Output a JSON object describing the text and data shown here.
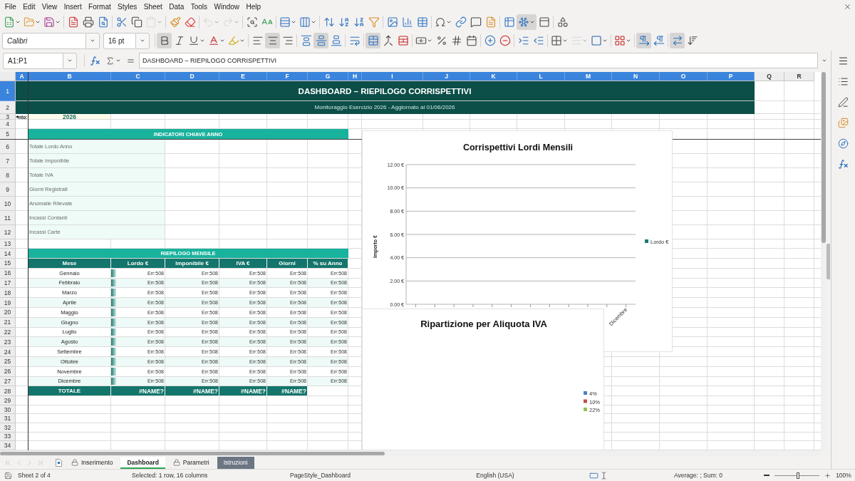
{
  "menu": [
    "File",
    "Edit",
    "View",
    "Insert",
    "Format",
    "Styles",
    "Sheet",
    "Data",
    "Tools",
    "Window",
    "Help"
  ],
  "standard_toolbar": [
    {
      "on": false,
      "disabled": false
    },
    {
      "on": false,
      "disabled": false
    },
    {
      "on": false,
      "disabled": false
    },
    {
      "on": false,
      "disabled": false
    },
    {
      "on": false,
      "disabled": false
    },
    {
      "on": false,
      "disabled": false
    },
    {
      "on": false,
      "disabled": false
    },
    {
      "on": false,
      "disabled": false
    },
    {
      "on": false,
      "disabled": true
    },
    {
      "on": false,
      "disabled": false
    },
    {
      "on": false,
      "disabled": false
    },
    {
      "on": false,
      "disabled": true
    },
    {
      "on": false,
      "disabled": true
    },
    {
      "on": false,
      "disabled": false
    },
    {
      "on": false,
      "disabled": false
    },
    {
      "on": false,
      "disabled": false
    },
    {
      "on": false,
      "disabled": false
    },
    {
      "on": false,
      "disabled": false
    },
    {
      "on": false,
      "disabled": false
    },
    {
      "on": false,
      "disabled": false
    },
    {
      "on": false,
      "disabled": false
    },
    {
      "on": false,
      "disabled": false
    },
    {
      "on": false,
      "disabled": false
    },
    {
      "on": false,
      "disabled": false
    },
    {
      "on": false,
      "disabled": false
    },
    {
      "on": false,
      "disabled": false
    },
    {
      "on": false,
      "disabled": false
    },
    {
      "on": false,
      "disabled": false
    },
    {
      "on": false,
      "disabled": false
    },
    {
      "on": true,
      "disabled": false
    },
    {
      "on": false,
      "disabled": false
    },
    {
      "on": false,
      "disabled": false
    }
  ],
  "formatting_toolbar": {
    "font_name": "Calibri",
    "font_size": "16 pt",
    "buttons": [
      {
        "on": true,
        "disabled": false
      },
      {
        "on": false,
        "disabled": false
      },
      {
        "on": false,
        "disabled": false
      },
      {
        "on": false,
        "disabled": false
      },
      {
        "on": false,
        "disabled": false
      },
      {
        "on": false,
        "disabled": false
      },
      {
        "on": true,
        "disabled": false
      },
      {
        "on": false,
        "disabled": false
      },
      {
        "on": false,
        "disabled": false
      },
      {
        "on": true,
        "disabled": false
      },
      {
        "on": false,
        "disabled": false
      },
      {
        "on": false,
        "disabled": false
      },
      {
        "on": true,
        "disabled": false
      },
      {
        "on": false,
        "disabled": false
      },
      {
        "on": false,
        "disabled": false
      },
      {
        "on": false,
        "disabled": false
      },
      {
        "on": false,
        "disabled": false
      },
      {
        "on": false,
        "disabled": false
      },
      {
        "on": false,
        "disabled": false
      },
      {
        "on": false,
        "disabled": false
      },
      {
        "on": false,
        "disabled": false
      },
      {
        "on": false,
        "disabled": false
      },
      {
        "on": false,
        "disabled": false
      },
      {
        "on": false,
        "disabled": false
      },
      {
        "on": false,
        "disabled": true
      },
      {
        "on": false,
        "disabled": false
      },
      {
        "on": false,
        "disabled": false
      },
      {
        "on": true,
        "disabled": false
      },
      {
        "on": false,
        "disabled": false
      },
      {
        "on": true,
        "disabled": false
      },
      {
        "on": false,
        "disabled": false
      }
    ]
  },
  "formula_bar": {
    "name_box": "A1:P1",
    "formula": "DASHBOARD – RIEPILOGO CORRISPETTIVI"
  },
  "sheet": {
    "columns": [
      {
        "label": "A",
        "selected": true
      },
      {
        "label": "B",
        "selected": true
      },
      {
        "label": "C",
        "selected": true
      },
      {
        "label": "D",
        "selected": true
      },
      {
        "label": "E",
        "selected": true
      },
      {
        "label": "F",
        "selected": true
      },
      {
        "label": "G",
        "selected": true
      },
      {
        "label": "H",
        "selected": true
      },
      {
        "label": "I",
        "selected": true
      },
      {
        "label": "J",
        "selected": true
      },
      {
        "label": "K",
        "selected": true
      },
      {
        "label": "L",
        "selected": true
      },
      {
        "label": "M",
        "selected": true
      },
      {
        "label": "N",
        "selected": true
      },
      {
        "label": "O",
        "selected": true
      },
      {
        "label": "P",
        "selected": true
      },
      {
        "label": "Q",
        "selected": false
      },
      {
        "label": "R",
        "selected": false
      }
    ],
    "rows": [
      {
        "label": "1",
        "selected": true
      },
      {
        "label": "2",
        "selected": false
      },
      {
        "label": "3",
        "selected": false
      },
      {
        "label": "4",
        "selected": false
      },
      {
        "label": "5",
        "selected": false
      },
      {
        "label": "6",
        "selected": false
      },
      {
        "label": "7",
        "selected": false
      },
      {
        "label": "8",
        "selected": false
      },
      {
        "label": "9",
        "selected": false
      },
      {
        "label": "10",
        "selected": false
      },
      {
        "label": "11",
        "selected": false
      },
      {
        "label": "12",
        "selected": false
      },
      {
        "label": "13",
        "selected": false
      },
      {
        "label": "14",
        "selected": false
      },
      {
        "label": "15",
        "selected": false
      },
      {
        "label": "16",
        "selected": false
      },
      {
        "label": "17",
        "selected": false
      },
      {
        "label": "18",
        "selected": false
      },
      {
        "label": "19",
        "selected": false
      },
      {
        "label": "20",
        "selected": false
      },
      {
        "label": "21",
        "selected": false
      },
      {
        "label": "22",
        "selected": false
      },
      {
        "label": "23",
        "selected": false
      },
      {
        "label": "24",
        "selected": false
      },
      {
        "label": "25",
        "selected": false
      },
      {
        "label": "26",
        "selected": false
      },
      {
        "label": "27",
        "selected": false
      },
      {
        "label": "28",
        "selected": false
      },
      {
        "label": "29",
        "selected": false
      },
      {
        "label": "30",
        "selected": false
      },
      {
        "label": "31",
        "selected": false
      },
      {
        "label": "32",
        "selected": false
      },
      {
        "label": "33",
        "selected": false
      },
      {
        "label": "34",
        "selected": false
      }
    ],
    "title": "DASHBOARD – RIEPILOGO CORRISPETTIVI",
    "subtitle": "Monitoraggio Esercizio 2026 - Aggiornato al 01/06/2026",
    "year_label": "nto:",
    "year": "2026",
    "kpi_header": "INDICATORI CHIAVE ANNO",
    "kpis": [
      "Totale Lordo Anno",
      "Totale Imponibile",
      "Totale IVA",
      "Giorni Registrati",
      "Anomalie Rilevate",
      "Incassi Contanti",
      "Incassi Carte"
    ],
    "summary_header": "RIEPILOGO MENSILE",
    "summary_columns": [
      "Mese",
      "Lordo €",
      "Imponibile €",
      "IVA €",
      "Giorni",
      "% su Anno"
    ],
    "months": [
      {
        "name": "Gennaio",
        "values": [
          "Err:508",
          "Err:508",
          "Err:508",
          "Err:508",
          "Err:508"
        ]
      },
      {
        "name": "Febbraio",
        "values": [
          "Err:508",
          "Err:508",
          "Err:508",
          "Err:508",
          "Err:508"
        ]
      },
      {
        "name": "Marzo",
        "values": [
          "Err:508",
          "Err:508",
          "Err:508",
          "Err:508",
          "Err:508"
        ]
      },
      {
        "name": "Aprile",
        "values": [
          "Err:508",
          "Err:508",
          "Err:508",
          "Err:508",
          "Err:508"
        ]
      },
      {
        "name": "Maggio",
        "values": [
          "Err:508",
          "Err:508",
          "Err:508",
          "Err:508",
          "Err:508"
        ]
      },
      {
        "name": "Giugno",
        "values": [
          "Err:508",
          "Err:508",
          "Err:508",
          "Err:508",
          "Err:508"
        ]
      },
      {
        "name": "Luglio",
        "values": [
          "Err:508",
          "Err:508",
          "Err:508",
          "Err:508",
          "Err:508"
        ]
      },
      {
        "name": "Agosto",
        "values": [
          "Err:508",
          "Err:508",
          "Err:508",
          "Err:508",
          "Err:508"
        ]
      },
      {
        "name": "Settembre",
        "values": [
          "Err:508",
          "Err:508",
          "Err:508",
          "Err:508",
          "Err:508"
        ]
      },
      {
        "name": "Ottobre",
        "values": [
          "Err:508",
          "Err:508",
          "Err:508",
          "Err:508",
          "Err:508"
        ]
      },
      {
        "name": "Novembre",
        "values": [
          "Err:508",
          "Err:508",
          "Err:508",
          "Err:508",
          "Err:508"
        ]
      },
      {
        "name": "Dicembre",
        "values": [
          "Err:508",
          "Err:508",
          "Err:508",
          "Err:508",
          "Err:508"
        ]
      }
    ],
    "totals": {
      "label": "TOTALE",
      "values": [
        "#NAME?",
        "#NAME?",
        "#NAME?",
        "#NAME?"
      ]
    }
  },
  "charts": [
    {
      "kind": "bar",
      "title": "Corrispettivi Lordi Mensili",
      "axis_title": "Importo €",
      "y_ticks": [
        "12.00 €",
        "10.00 €",
        "8.00 €",
        "6.00 €",
        "4.00 €",
        "2.00 €",
        "0.00 €"
      ],
      "x_labels": [
        "Dicembre"
      ],
      "legend": [
        {
          "label": "Lordo €",
          "color": "#1b7a70"
        }
      ]
    },
    {
      "kind": "pie",
      "title": "Ripartizione per Aliquota IVA",
      "legend": [
        {
          "label": "4%",
          "color": "#4f81bd"
        },
        {
          "label": "10%",
          "color": "#c0504d"
        },
        {
          "label": "22%",
          "color": "#9bbb59"
        }
      ]
    }
  ],
  "sheet_tabs": [
    {
      "label": "Inserimento",
      "selected": false,
      "locked": true
    },
    {
      "label": "Dashboard",
      "selected": true,
      "locked": false
    },
    {
      "label": "Parametri",
      "selected": false,
      "locked": true
    },
    {
      "label": "Istruzioni",
      "selected": false,
      "locked": false,
      "color": "#6b7583"
    }
  ],
  "status_bar": {
    "sheet": "Sheet 2 of 4",
    "selection": "Selected: 1 row, 16 columns",
    "page_style": "PageStyle_Dashboard",
    "language": "English (USA)",
    "summary": "Average: ; Sum: 0",
    "zoom": {
      "level": 0.52,
      "reading": "100%"
    }
  }
}
